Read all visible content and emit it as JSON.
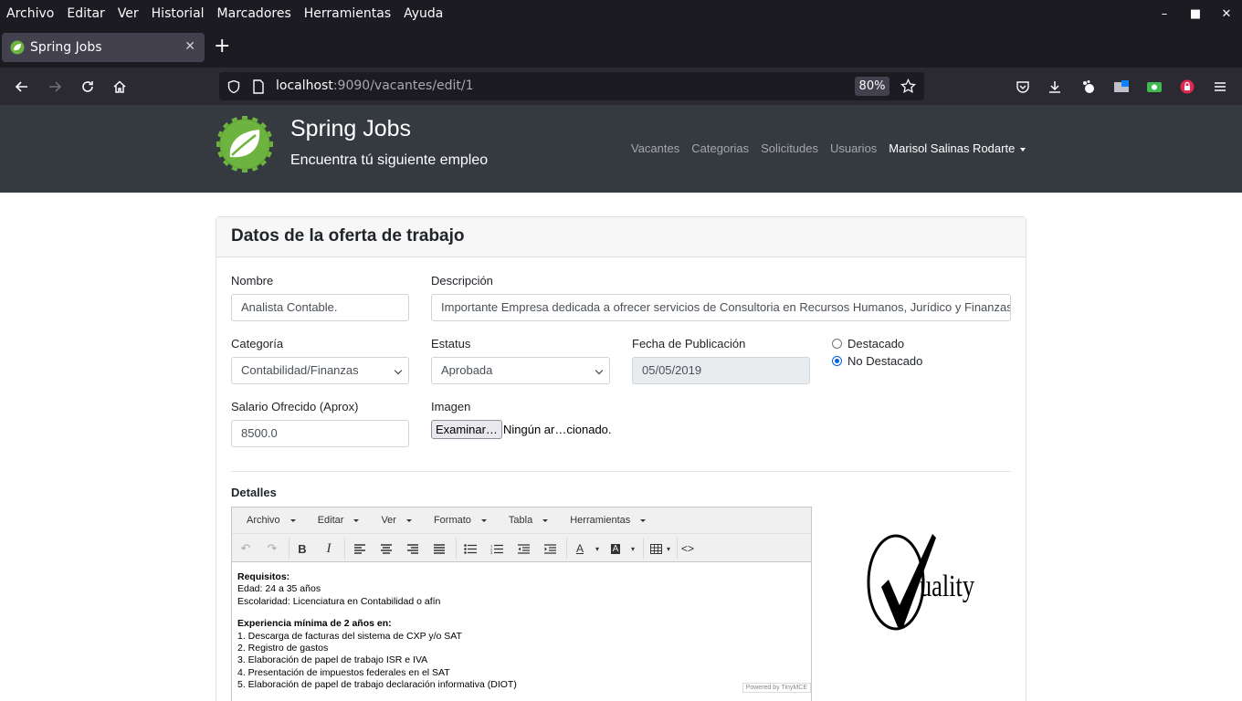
{
  "browser": {
    "menu": [
      "Archivo",
      "Editar",
      "Ver",
      "Historial",
      "Marcadores",
      "Herramientas",
      "Ayuda"
    ],
    "tab_title": "Spring Jobs",
    "url_host": "localhost",
    "url_path": ":9090/vacantes/edit/1",
    "zoom": "80%"
  },
  "site": {
    "title": "Spring Jobs",
    "subtitle": "Encuentra tú siguiente empleo",
    "nav": [
      "Vacantes",
      "Categorias",
      "Solicitudes",
      "Usuarios"
    ],
    "user": "Marisol Salinas Rodarte",
    "brand_color": "#6db33f"
  },
  "form": {
    "card_title": "Datos de la oferta de trabajo",
    "nombre_label": "Nombre",
    "nombre_value": "Analista Contable.",
    "descripcion_label": "Descripción",
    "descripcion_value": "Importante Empresa dedicada a ofrecer servicios de Consultoria en Recursos Humanos, Jurídico y Finanzas",
    "categoria_label": "Categoría",
    "categoria_value": "Contabilidad/Finanzas",
    "estatus_label": "Estatus",
    "estatus_value": "Aprobada",
    "fecha_label": "Fecha de Publicación",
    "fecha_value": "05/05/2019",
    "destacado_label": "Destacado",
    "no_destacado_label": "No Destacado",
    "destacado_selected": "No Destacado",
    "salario_label": "Salario Ofrecido (Aprox)",
    "salario_value": "8500.0",
    "imagen_label": "Imagen",
    "file_button": "Examinar…",
    "file_status": "Ningún ar…cionado.",
    "detalles_label": "Detalles"
  },
  "editor": {
    "menu": [
      "Archivo",
      "Editar",
      "Ver",
      "Formato",
      "Tabla",
      "Herramientas"
    ],
    "powered": "Powered by TinyMCE",
    "content": {
      "req_title": "Requisitos:",
      "req_lines": [
        "Edad: 24 a 35 años",
        "Escolaridad: Licenciatura en Contabilidad o afín"
      ],
      "exp_title": "Experiencia mínima de 2 años en:",
      "exp_lines": [
        "1. Descarga de facturas del sistema de CXP y/o SAT",
        "2. Registro de gastos",
        "3. Elaboración de papel de trabajo ISR e IVA",
        "4. Presentación de impuestos federales en el SAT",
        "5. Elaboración de papel de trabajo declaración informativa (DIOT)"
      ]
    }
  },
  "image_preview": {
    "word": "uality"
  }
}
